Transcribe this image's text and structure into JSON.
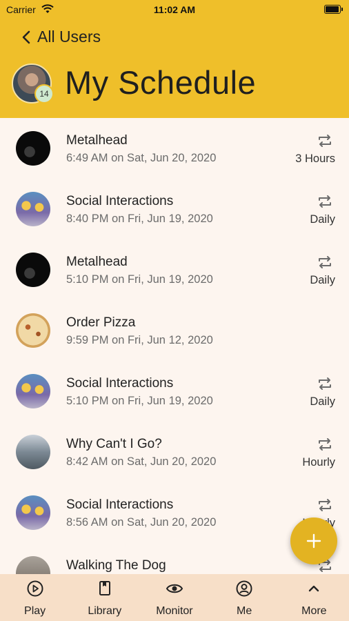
{
  "status_bar": {
    "carrier": "Carrier",
    "time": "11:02 AM"
  },
  "nav": {
    "back_label": "All Users",
    "title": "My Schedule",
    "avatar_badge": "14"
  },
  "schedule": [
    {
      "name": "Metalhead",
      "when": "6:49 AM on Sat, Jun 20, 2020",
      "frequency": "3 Hours",
      "thumb": "metal"
    },
    {
      "name": "Social Interactions",
      "when": "8:40 PM on Fri, Jun 19, 2020",
      "frequency": "Daily",
      "thumb": "social"
    },
    {
      "name": "Metalhead",
      "when": "5:10 PM on Fri, Jun 19, 2020",
      "frequency": "Daily",
      "thumb": "metal"
    },
    {
      "name": "Order Pizza",
      "when": "9:59 PM on Fri, Jun 12, 2020",
      "frequency": "",
      "thumb": "pizza"
    },
    {
      "name": "Social Interactions",
      "when": "5:10 PM on Fri, Jun 19, 2020",
      "frequency": "Daily",
      "thumb": "social"
    },
    {
      "name": "Why Can't I Go?",
      "when": "8:42 AM on Sat, Jun 20, 2020",
      "frequency": "Hourly",
      "thumb": "why"
    },
    {
      "name": "Social Interactions",
      "when": "8:56 AM on Sat, Jun 20, 2020",
      "frequency": "Hourly",
      "thumb": "social"
    },
    {
      "name": "Walking The Dog",
      "when": "",
      "frequency": "",
      "thumb": "dog"
    }
  ],
  "tabs": [
    {
      "label": "Play",
      "icon": "play-icon"
    },
    {
      "label": "Library",
      "icon": "book-icon"
    },
    {
      "label": "Monitor",
      "icon": "eye-icon"
    },
    {
      "label": "Me",
      "icon": "person-icon"
    },
    {
      "label": "More",
      "icon": "chevron-up-icon"
    }
  ],
  "colors": {
    "header": "#efbf2a",
    "fab": "#e3b322",
    "tabbar": "#f7dfc8",
    "background": "#fdf5ef"
  }
}
